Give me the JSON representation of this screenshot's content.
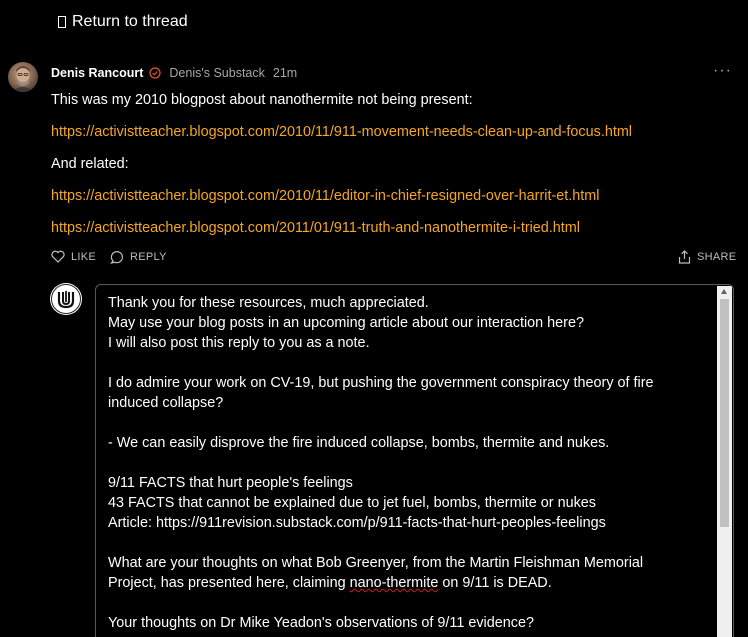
{
  "nav": {
    "return_label": "Return to thread"
  },
  "comment": {
    "author": "Denis Rancourt",
    "publication": "Denis's Substack",
    "time": "21m",
    "more_icon": "more-dots-icon",
    "body": [
      {
        "type": "text",
        "text": "This was my 2010 blogpost about nanothermite not being present:"
      },
      {
        "type": "link",
        "text": "https://activistteacher.blogspot.com/2010/11/911-movement-needs-clean-up-and-focus.html"
      },
      {
        "type": "text",
        "text": "And related:"
      },
      {
        "type": "link",
        "text": "https://activistteacher.blogspot.com/2010/11/editor-in-chief-resigned-over-harrit-et.html"
      },
      {
        "type": "link",
        "text": "https://activistteacher.blogspot.com/2011/01/911-truth-and-nanothermite-i-tried.html"
      }
    ],
    "actions": {
      "like": "LIKE",
      "reply": "REPLY",
      "share": "SHARE"
    },
    "link_color": "#f5a623"
  },
  "reply_editor": {
    "lines": [
      "Thank you for these resources, much appreciated.",
      "May use your blog posts in an upcoming article about our interaction here?",
      "I will also post this reply to you as a note.",
      "",
      "I do admire your work on CV-19, but pushing the government conspiracy theory of fire",
      "induced collapse?",
      "",
      "- We can easily disprove the fire induced collapse, bombs, thermite and nukes.",
      "",
      "9/11 FACTS that hurt people's feelings",
      "43 FACTS that cannot be explained due to jet fuel, bombs, thermite or nukes",
      "Article: https://911revision.substack.com/p/911-facts-that-hurt-peoples-feelings",
      "",
      "What are your thoughts on what Bob Greenyer, from the Martin Fleishman Memorial",
      "Project, has presented here, claiming nano-thermite on 9/11 is DEAD.",
      "",
      "Your thoughts on Dr Mike Yeadon's observations of 9/11 evidence?"
    ],
    "misspelled_word": "nano-thermite"
  }
}
